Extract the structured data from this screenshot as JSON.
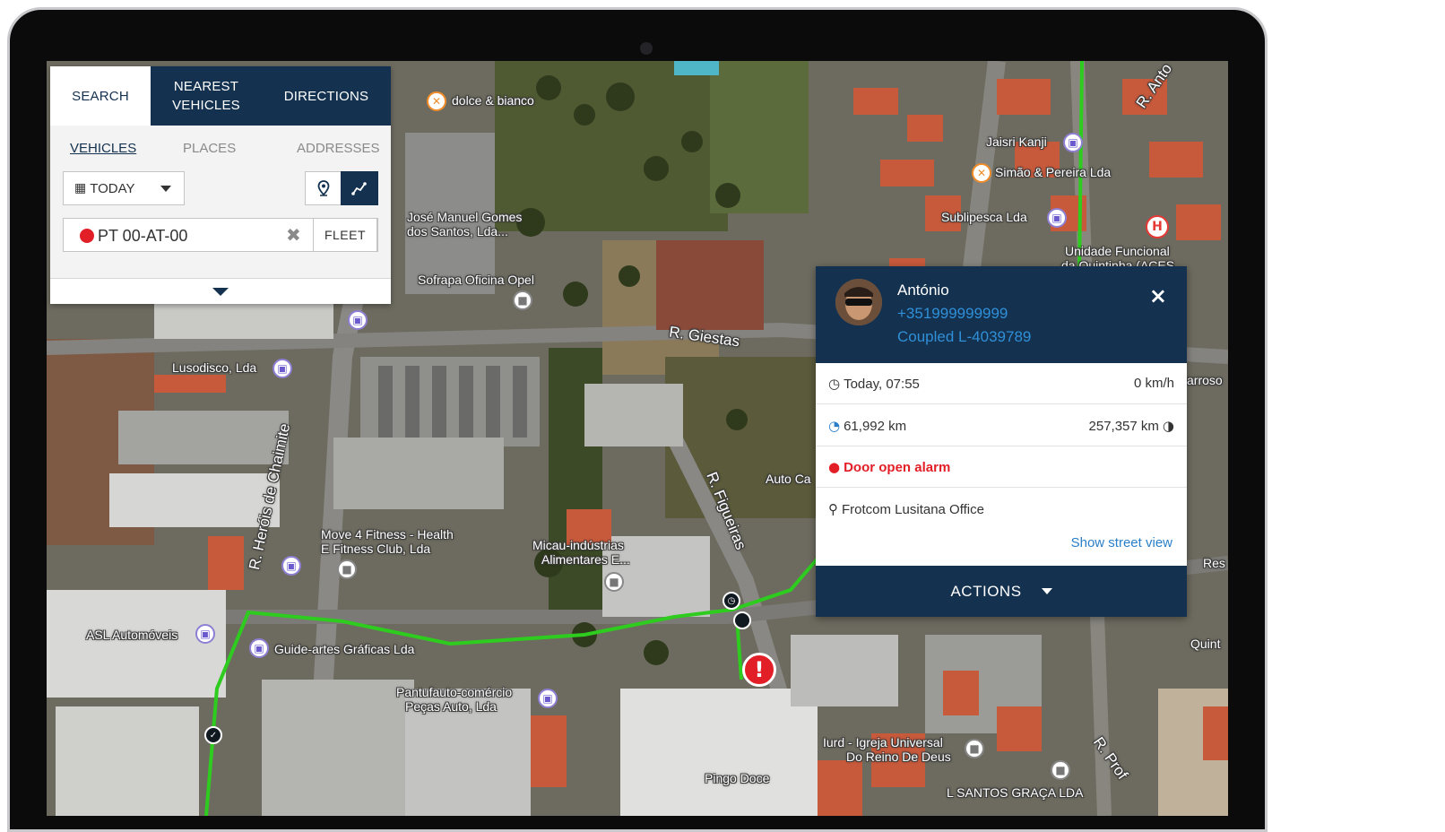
{
  "search_panel": {
    "tabs": [
      "SEARCH",
      "NEAREST VEHICLES",
      "DIRECTIONS"
    ],
    "active_tab": "SEARCH",
    "subtabs": [
      "VEHICLES",
      "PLACES",
      "ADDRESSES"
    ],
    "active_subtab": "VEHICLES",
    "period_label": "TODAY",
    "plate": "PT 00-AT-00",
    "plate_status_color": "#e21f26",
    "fleet_label": "FLEET",
    "icons": [
      "calendar-icon",
      "pin-icon",
      "route-icon",
      "clear-icon",
      "chevron-down-icon"
    ]
  },
  "vehicle_popup": {
    "driver_name": "António",
    "phone": "+351999999999",
    "coupled": "Coupled L-4039789",
    "close_icon": "×",
    "datetime": "Today, 07:55",
    "speed": "0 km/h",
    "odometer": "61,992 km",
    "total_km": "257,357 km",
    "alarm": "Door open alarm",
    "location": "Frotcom Lusitana Office",
    "street_view_link": "Show street view",
    "actions_label": "ACTIONS"
  },
  "map": {
    "labels": [
      "dolce & bianco",
      "Jaisri Kanji",
      "Simão & Pereira Lda",
      "Sublipesca Lda",
      "Unidade Funcional",
      "da Quintinha (ACES",
      "R. Anto",
      "José Manuel Gomes",
      "dos Santos, Lda...",
      "Sofrapa Oficina Opel",
      "R. Giestas",
      "Lusodisco, Lda",
      "R. Heróis de Chaimite",
      "Auto Ca",
      "R. Figueiras",
      "Move 4 Fitness - Health",
      "E Fitness Club, Lda",
      "Micau-indústrias",
      "Alimentares E...",
      "ASL Automóveis",
      "Guide-artes Gráficas Lda",
      "Pantufauto-comércio",
      "Peças Auto, Lda",
      "Iurd - Igreja Universal",
      "Do Reino De Deus",
      "Pingo Doce",
      "L SANTOS GRAÇA LDA",
      "R. Prof",
      "Quint",
      "Res",
      "arroso"
    ],
    "route_color": "#2ecc1f",
    "alarm_marker_color": "#e21f26"
  }
}
